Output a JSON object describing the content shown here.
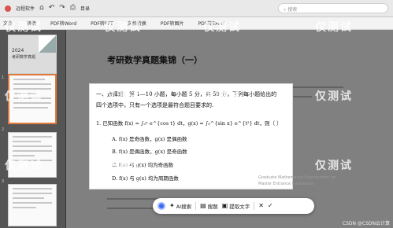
{
  "toolbar": {
    "items": [
      "远程软件",
      "目录",
      "搜索"
    ],
    "search_placeholder": "搜索"
  },
  "docbar": {
    "items": [
      "文件",
      "转换",
      "PDF转Word",
      "PDF转PPT",
      "文档转换",
      "PDF转图片",
      "PDF转Excel"
    ]
  },
  "sidebar": {
    "cover_year": "2024",
    "cover_title": "考研数学真题",
    "page_numbers": [
      "1",
      "2",
      "3"
    ]
  },
  "page": {
    "title": "考研数学真题集锦（一）"
  },
  "capture": {
    "line1": "一、选择题：第 1—10 小题，每小题 5 分，共 50 分，下列每小题给出的",
    "line2": "四个选项中，只有一个选项是最符合题目要求的.",
    "question": "1. 已知函数 f(x) = ∫₀ˣ e^{cos t} dt，g(x) = ∫₀^{sin x} e^{t²} dt，则（    ）",
    "options": [
      "A.  f(x) 是奇函数，g(x) 是偶函数",
      "B.  f(x) 是偶函数，g(x) 是奇函数",
      "C.  f(x) 与 g(x) 均为奇函数",
      "D.  f(x) 与 g(x) 均为周期函数"
    ],
    "watermark_en_1": "Graduate Mathematics Examination for",
    "watermark_en_2": "Master Entrance Institutions"
  },
  "float_toolbar": {
    "ai_search": "AI搜索",
    "tihuo": "搜题",
    "extract_text": "提取文字",
    "close": "✕",
    "confirm": "✓"
  },
  "watermark": "仅测试",
  "credit": "CSDN @CSDN云计算"
}
